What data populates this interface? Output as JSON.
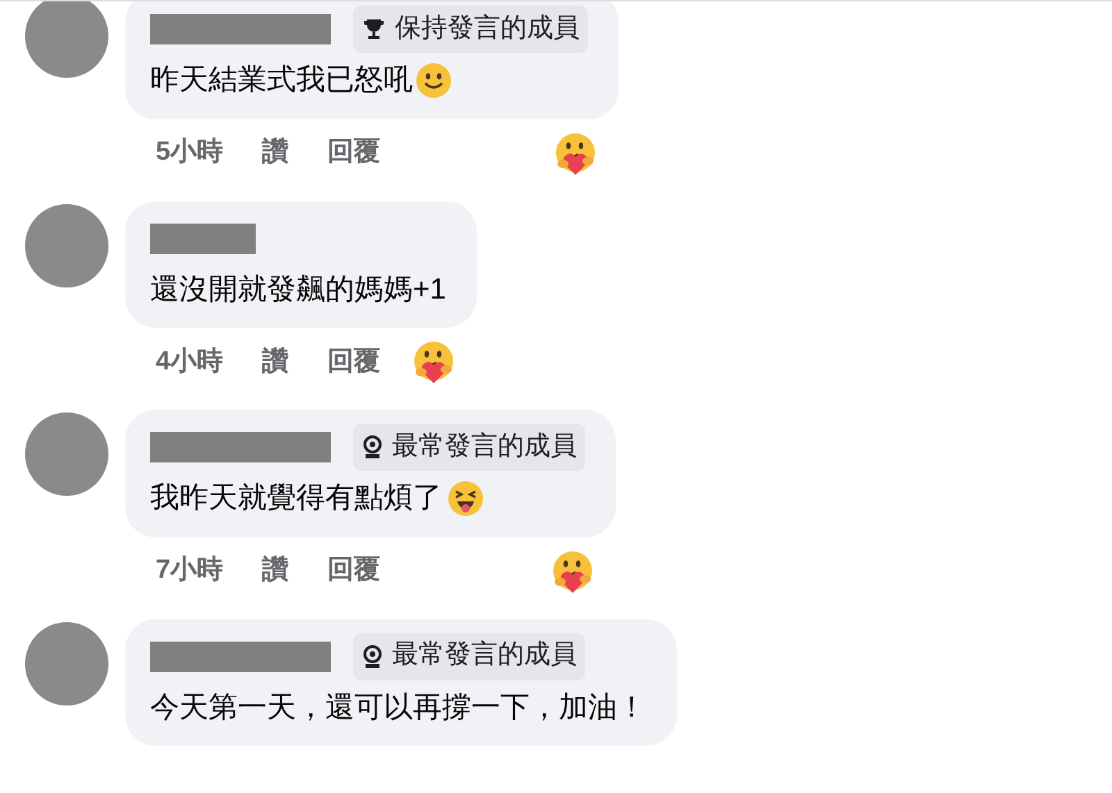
{
  "comments": [
    {
      "badge": {
        "kind": "trophy",
        "label": "保持發言的成員"
      },
      "text": "昨天結業式我已怒吼",
      "emoji": {
        "kind": "smile"
      },
      "time": "5小時",
      "like": "讚",
      "reply": "回覆",
      "reaction": true
    },
    {
      "text": "還沒開就發飆的媽媽+1",
      "time": "4小時",
      "like": "讚",
      "reply": "回覆",
      "reaction": true
    },
    {
      "badge": {
        "kind": "rising",
        "label": "最常發言的成員"
      },
      "text": "我昨天就覺得有點煩了",
      "emoji": {
        "kind": "squint_tongue"
      },
      "time": "7小時",
      "like": "讚",
      "reply": "回覆",
      "reaction": true
    },
    {
      "badge": {
        "kind": "rising",
        "label": "最常發言的成員"
      },
      "text": "今天第一天，還可以再撐一下，加油！"
    }
  ]
}
